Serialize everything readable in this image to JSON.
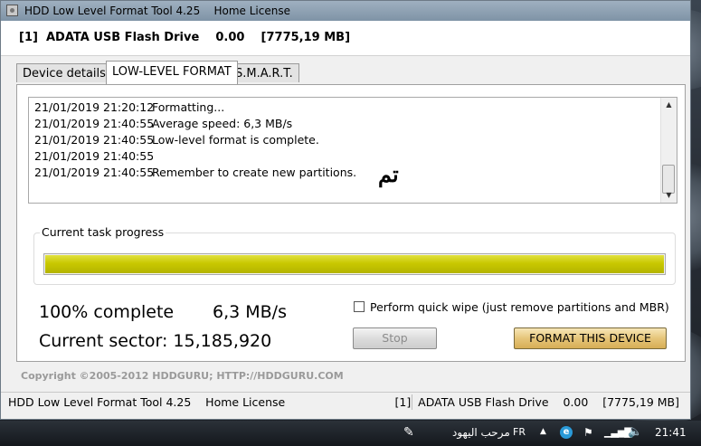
{
  "window": {
    "title": "HDD Low Level Format Tool 4.25",
    "license": "Home License"
  },
  "device": {
    "header": "[1]  ADATA USB Flash Drive    0.00    [7775,19 MB]"
  },
  "tabs": [
    {
      "label": "Device details",
      "active": false
    },
    {
      "label": "LOW-LEVEL FORMAT",
      "active": true
    },
    {
      "label": "S.M.A.R.T.",
      "active": false
    }
  ],
  "log": [
    {
      "time": "21/01/2019 21:20:12",
      "message": "Formatting..."
    },
    {
      "time": "21/01/2019 21:40:55",
      "message": "Average speed: 6,3 MB/s"
    },
    {
      "time": "21/01/2019 21:40:55",
      "message": "Low-level format is complete."
    },
    {
      "time": "21/01/2019 21:40:55",
      "message": ""
    },
    {
      "time": "21/01/2019 21:40:55",
      "message": "Remember to create new partitions."
    }
  ],
  "overlay_text": "تم",
  "progress": {
    "label": "Current task progress",
    "fraction": 1.0,
    "color": "#c9c800"
  },
  "stats": {
    "complete": "100% complete",
    "speed": "6,3 MB/s",
    "sector": "Current sector: 15,185,920"
  },
  "options": {
    "quick_wipe_label": "Perform quick wipe (just remove partitions and MBR)",
    "quick_wipe_checked": false
  },
  "buttons": {
    "stop": "Stop",
    "format": "FORMAT THIS DEVICE"
  },
  "copyright": "Copyright ©2005-2012 HDDGURU;  HTTP://HDDGURU.COM",
  "statusbar": {
    "left": "HDD Low Level Format Tool 4.25    Home License",
    "right": "[1]  ADATA USB Flash Drive    0.00    [7775,19 MB]"
  },
  "taskbar": {
    "language_arabic": "مرحب اليهود",
    "language": "FR",
    "clock": "21:41",
    "icons": [
      "notepad-icon",
      "show-hidden-icons",
      "ie-icon",
      "flag-icon",
      "network-signal-icon",
      "volume-icon"
    ]
  }
}
